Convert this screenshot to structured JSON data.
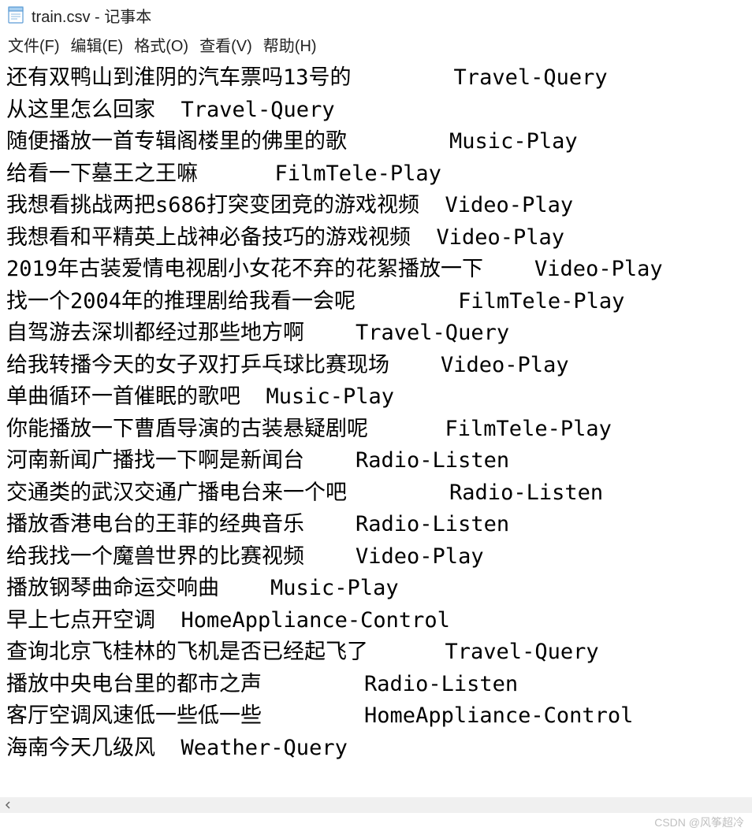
{
  "title": "train.csv - 记事本",
  "menu": {
    "file": "文件(F)",
    "edit": "编辑(E)",
    "format": "格式(O)",
    "view": "查看(V)",
    "help": "帮助(H)"
  },
  "lines": [
    "还有双鸭山到淮阴的汽车票吗13号的\tTravel-Query",
    "从这里怎么回家\tTravel-Query",
    "随便播放一首专辑阁楼里的佛里的歌\tMusic-Play",
    "给看一下墓王之王嘛\tFilmTele-Play",
    "我想看挑战两把s686打突变团竞的游戏视频\tVideo-Play",
    "我想看和平精英上战神必备技巧的游戏视频\tVideo-Play",
    "2019年古装爱情电视剧小女花不弃的花絮播放一下\tVideo-Play",
    "找一个2004年的推理剧给我看一会呢\tFilmTele-Play",
    "自驾游去深圳都经过那些地方啊\tTravel-Query",
    "给我转播今天的女子双打乒乓球比赛现场\tVideo-Play",
    "单曲循环一首催眠的歌吧\tMusic-Play",
    "你能播放一下曹盾导演的古装悬疑剧呢\tFilmTele-Play",
    "河南新闻广播找一下啊是新闻台\tRadio-Listen",
    "交通类的武汉交通广播电台来一个吧\tRadio-Listen",
    "播放香港电台的王菲的经典音乐\tRadio-Listen",
    "给我找一个魔兽世界的比赛视频\tVideo-Play",
    "播放钢琴曲命运交响曲\tMusic-Play",
    "早上七点开空调\tHomeAppliance-Control",
    "查询北京飞桂林的飞机是否已经起飞了\tTravel-Query",
    "播放中央电台里的都市之声\tRadio-Listen",
    "客厅空调风速低一些低一些\tHomeAppliance-Control",
    "海南今天几级风\tWeather-Query"
  ],
  "watermark": "CSDN @风筝超冷",
  "tab_width": 8
}
